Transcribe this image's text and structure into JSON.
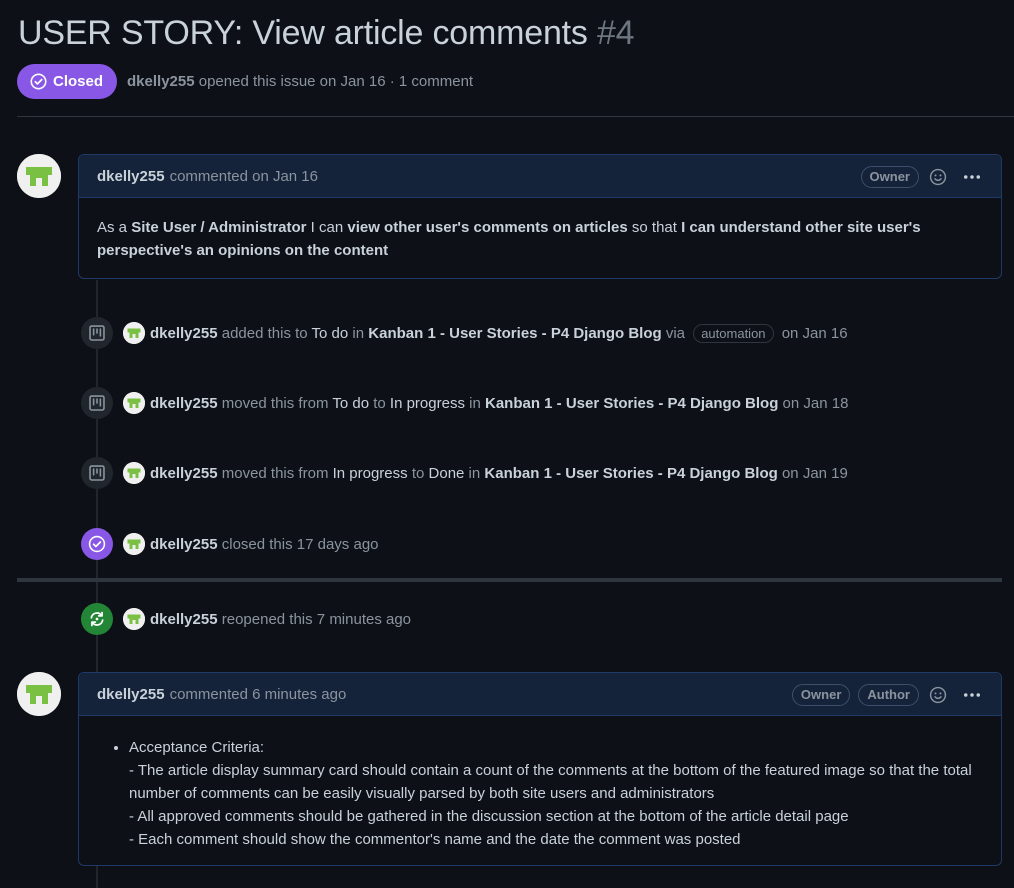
{
  "issue": {
    "title": "USER STORY: View article comments",
    "number": "#4",
    "status": "Closed",
    "author": "dkelly255",
    "meta_text": "opened this issue on Jan 16 · 1 comment"
  },
  "comment1": {
    "author": "dkelly255",
    "action": "commented on Jan 16",
    "badge_owner": "Owner",
    "body": {
      "p1": "As a ",
      "b1": "Site User / Administrator",
      "p2": " I can ",
      "b2": "view other user's comments on articles",
      "p3": " so that ",
      "b3": "I can understand other site user's perspective's an opinions on the content"
    }
  },
  "events": [
    {
      "user": "dkelly255",
      "t1": "added this to",
      "v1": "To do",
      "t2": "in",
      "board": "Kanban 1 - User Stories - P4 Django Blog",
      "t3": "via",
      "badge": "automation",
      "date": "on Jan 16"
    },
    {
      "user": "dkelly255",
      "t1": "moved this from",
      "v1": "To do",
      "t2": "to",
      "v2": "In progress",
      "t3": "in",
      "board": "Kanban 1 - User Stories - P4 Django Blog",
      "date": "on Jan 18"
    },
    {
      "user": "dkelly255",
      "t1": "moved this from",
      "v1": "In progress",
      "t2": "to",
      "v2": "Done",
      "t3": "in",
      "board": "Kanban 1 - User Stories - P4 Django Blog",
      "date": "on Jan 19"
    },
    {
      "user": "dkelly255",
      "text": "closed this 17 days ago"
    },
    {
      "user": "dkelly255",
      "text": "reopened this 7 minutes ago"
    }
  ],
  "comment2": {
    "author": "dkelly255",
    "action": "commented 6 minutes ago",
    "badge_owner": "Owner",
    "badge_author": "Author",
    "list_title": "Acceptance Criteria:",
    "lines": [
      "- The article display summary card should contain a count of the comments at the bottom of the featured image so that the total number of comments can be easily visually parsed by both site users and administrators",
      "- All approved comments should be gathered in the discussion section at the bottom of the article detail page",
      "- Each comment should show the commentor's name and the date the comment was posted"
    ]
  },
  "icons": {
    "status": "check-circle-icon",
    "project": "project-board-icon",
    "closed": "check-circle-icon",
    "reopened": "sync-icon",
    "reaction": "smiley-icon",
    "more": "kebab-horizontal-icon"
  },
  "colors": {
    "background": "#0d1117",
    "closed_purple": "#8957e5",
    "reopened_green": "#238636",
    "avatar_green": "#7ac143"
  }
}
